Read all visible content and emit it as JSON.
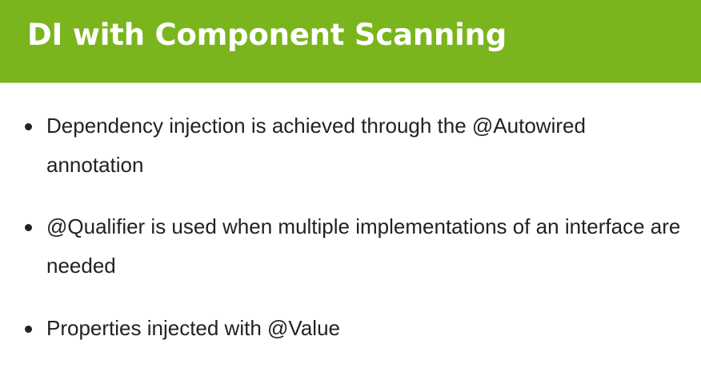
{
  "slide": {
    "title": "DI with Component Scanning",
    "accent_color": "#7ab51d",
    "bullets": [
      {
        "text": "Dependency injection is achieved through the @Autowired annotation"
      },
      {
        "text": "@Qualifier is used when multiple implementations of an interface are needed"
      },
      {
        "text": "Properties injected with @Value"
      }
    ]
  }
}
